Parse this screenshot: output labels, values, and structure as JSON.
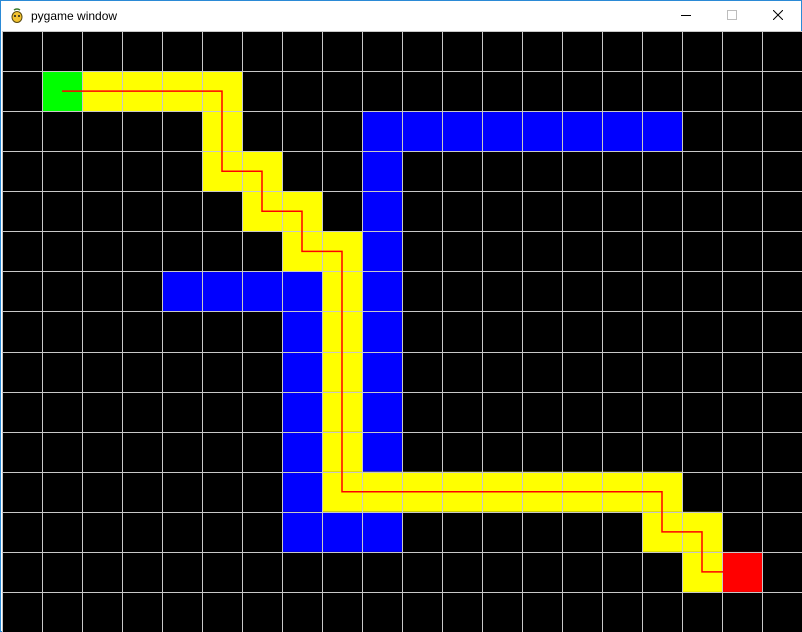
{
  "window": {
    "title": "pygame window",
    "icon": "pygame-snake-icon",
    "controls": [
      "minimize-icon",
      "maximize-icon",
      "close-icon"
    ]
  },
  "grid": {
    "columns": 20,
    "rows": 15,
    "background_color": "#000000",
    "line_color": "#c8c8c8"
  },
  "colors": {
    "start": "#00ff00",
    "end": "#ff0000",
    "wall": "#0000ff",
    "path": "#ffff00",
    "path_line": "#ff0000"
  },
  "start_cell": [
    1,
    1
  ],
  "end_cell": [
    18,
    13
  ],
  "walls": [
    [
      9,
      2
    ],
    [
      10,
      2
    ],
    [
      11,
      2
    ],
    [
      12,
      2
    ],
    [
      13,
      2
    ],
    [
      14,
      2
    ],
    [
      15,
      2
    ],
    [
      16,
      2
    ],
    [
      9,
      3
    ],
    [
      9,
      4
    ],
    [
      9,
      5
    ],
    [
      9,
      6
    ],
    [
      9,
      7
    ],
    [
      9,
      8
    ],
    [
      9,
      9
    ],
    [
      9,
      10
    ],
    [
      4,
      6
    ],
    [
      5,
      6
    ],
    [
      6,
      6
    ],
    [
      7,
      6
    ],
    [
      7,
      7
    ],
    [
      7,
      8
    ],
    [
      7,
      9
    ],
    [
      7,
      10
    ],
    [
      7,
      11
    ],
    [
      7,
      12
    ],
    [
      8,
      12
    ],
    [
      9,
      12
    ]
  ],
  "path": [
    [
      1,
      1
    ],
    [
      2,
      1
    ],
    [
      3,
      1
    ],
    [
      4,
      1
    ],
    [
      5,
      1
    ],
    [
      5,
      2
    ],
    [
      5,
      3
    ],
    [
      6,
      3
    ],
    [
      6,
      4
    ],
    [
      7,
      4
    ],
    [
      7,
      5
    ],
    [
      8,
      5
    ],
    [
      8,
      6
    ],
    [
      8,
      7
    ],
    [
      8,
      8
    ],
    [
      8,
      9
    ],
    [
      8,
      10
    ],
    [
      8,
      11
    ],
    [
      9,
      11
    ],
    [
      10,
      11
    ],
    [
      11,
      11
    ],
    [
      12,
      11
    ],
    [
      13,
      11
    ],
    [
      14,
      11
    ],
    [
      15,
      11
    ],
    [
      16,
      11
    ],
    [
      16,
      12
    ],
    [
      17,
      12
    ],
    [
      17,
      13
    ],
    [
      18,
      13
    ]
  ]
}
